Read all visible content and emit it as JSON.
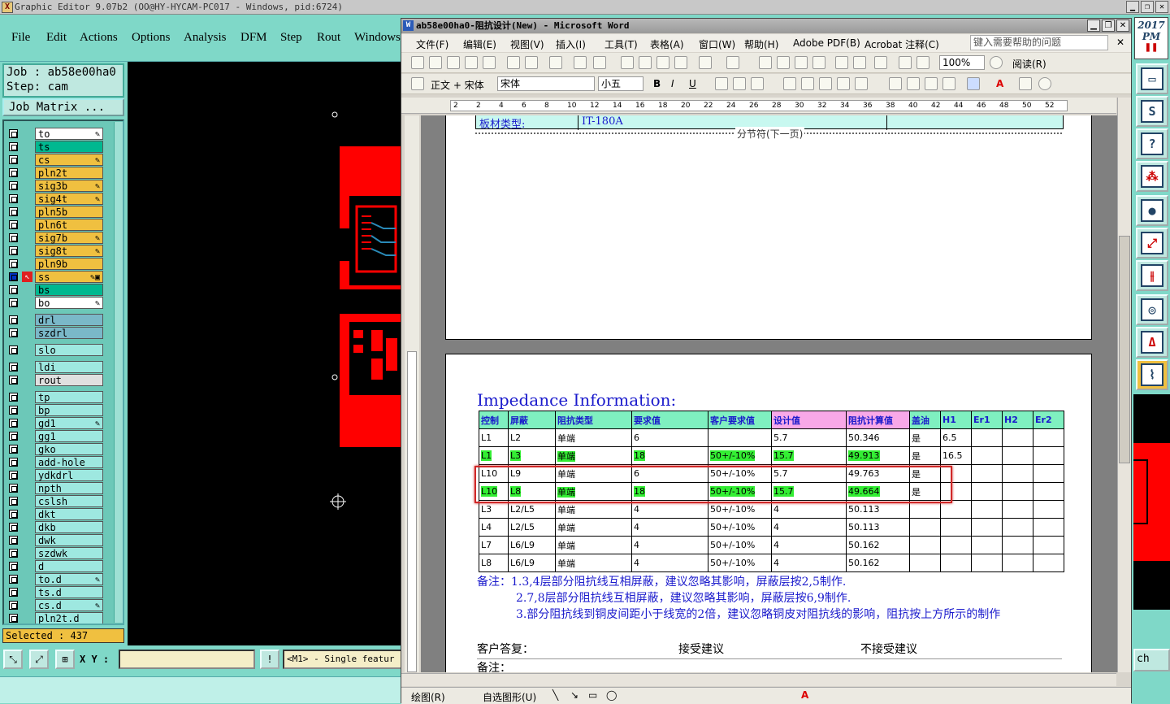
{
  "ge": {
    "title": "Graphic Editor 9.07b2 (OO@HY-HYCAM-PC017 - Windows, pid:6724)",
    "menu": [
      "File",
      "Edit",
      "Actions",
      "Options",
      "Analysis",
      "DFM",
      "Step",
      "Rout",
      "Windows"
    ],
    "job": "Job : ab58e00ha0",
    "step": "Step: cam",
    "job_matrix": "Job Matrix ...",
    "layers": [
      {
        "name": "to",
        "color": "#ffffff",
        "mark": "✎"
      },
      {
        "name": "ts",
        "color": "#00b890",
        "mark": ""
      },
      {
        "name": "cs",
        "color": "#f0c040",
        "mark": "✎"
      },
      {
        "name": "pln2t",
        "color": "#f0c040",
        "mark": ""
      },
      {
        "name": "sig3b",
        "color": "#f0c040",
        "mark": "✎"
      },
      {
        "name": "sig4t",
        "color": "#f0c040",
        "mark": "✎"
      },
      {
        "name": "pln5b",
        "color": "#f0c040",
        "mark": ""
      },
      {
        "name": "pln6t",
        "color": "#f0c040",
        "mark": ""
      },
      {
        "name": "sig7b",
        "color": "#f0c040",
        "mark": "✎"
      },
      {
        "name": "sig8t",
        "color": "#f0c040",
        "mark": "✎"
      },
      {
        "name": "pln9b",
        "color": "#f0c040",
        "mark": ""
      },
      {
        "name": "ss",
        "color": "#f0c040",
        "mark": "✎▣"
      },
      {
        "name": "bs",
        "color": "#00b890",
        "mark": ""
      },
      {
        "name": "bo",
        "color": "#ffffff",
        "mark": "✎"
      },
      {
        "name": "drl",
        "color": "#7ab8c8",
        "mark": ""
      },
      {
        "name": "szdrl",
        "color": "#7ab8c8",
        "mark": ""
      },
      {
        "name": "slo",
        "color": "#9ee8e0",
        "mark": ""
      },
      {
        "name": "ldi",
        "color": "#9ee8e0",
        "mark": ""
      },
      {
        "name": "rout",
        "color": "#e0e0e0",
        "mark": ""
      },
      {
        "name": "tp",
        "color": "#9ee8e0",
        "mark": ""
      },
      {
        "name": "bp",
        "color": "#9ee8e0",
        "mark": ""
      },
      {
        "name": "gd1",
        "color": "#9ee8e0",
        "mark": "✎"
      },
      {
        "name": "gg1",
        "color": "#9ee8e0",
        "mark": ""
      },
      {
        "name": "gko",
        "color": "#9ee8e0",
        "mark": ""
      },
      {
        "name": "add-hole",
        "color": "#9ee8e0",
        "mark": ""
      },
      {
        "name": "ydkdrl",
        "color": "#9ee8e0",
        "mark": ""
      },
      {
        "name": "npth",
        "color": "#9ee8e0",
        "mark": ""
      },
      {
        "name": "cslsh",
        "color": "#9ee8e0",
        "mark": ""
      },
      {
        "name": "dkt",
        "color": "#9ee8e0",
        "mark": ""
      },
      {
        "name": "dkb",
        "color": "#9ee8e0",
        "mark": ""
      },
      {
        "name": "dwk",
        "color": "#9ee8e0",
        "mark": ""
      },
      {
        "name": "szdwk",
        "color": "#9ee8e0",
        "mark": ""
      },
      {
        "name": "d",
        "color": "#9ee8e0",
        "mark": ""
      },
      {
        "name": "to.d",
        "color": "#9ee8e0",
        "mark": "✎"
      },
      {
        "name": "ts.d",
        "color": "#9ee8e0",
        "mark": ""
      },
      {
        "name": "cs.d",
        "color": "#9ee8e0",
        "mark": "✎"
      },
      {
        "name": "pln2t.d",
        "color": "#9ee8e0",
        "mark": ""
      }
    ],
    "selected": "Selected : 437",
    "xy_label": "X Y :",
    "message": "<M1> - Single featur",
    "clock_year": "2017",
    "clock_ampm": "PM",
    "right_edge_text": "ch"
  },
  "word": {
    "title": "ab58e00ha0-阻抗设计(New) - Microsoft Word",
    "menu": [
      "文件(F)",
      "编辑(E)",
      "视图(V)",
      "插入(I)",
      "工具(T)",
      "表格(A)",
      "窗口(W)",
      "帮助(H)",
      "Adobe PDF(B)",
      "Acrobat 注释(C)"
    ],
    "help_placeholder": "键入需要帮助的问题",
    "style": "正文 + 宋体",
    "font": "宋体",
    "size": "小五",
    "zoom": "100%",
    "read": "阅读(R)",
    "ruler_nums": [
      "2",
      "2",
      "4",
      "6",
      "8",
      "10",
      "12",
      "14",
      "16",
      "18",
      "20",
      "22",
      "24",
      "26",
      "28",
      "30",
      "32",
      "34",
      "36",
      "38",
      "40",
      "42",
      "44",
      "46",
      "48",
      "50",
      "52"
    ],
    "page1_row_label": "板材类型:",
    "page1_row_value": "IT-180A",
    "section_break": "分节符(下一页)",
    "imp_title": "Impedance Information:",
    "headers": [
      "控制",
      "屏蔽",
      "阻抗类型",
      "要求值",
      "客户要求值",
      "设计值",
      "阻抗计算值",
      "盖油",
      "H1",
      "Er1",
      "H2",
      "Er2"
    ],
    "rows": [
      {
        "hl": false,
        "cells": [
          "L1",
          "L2",
          "单端",
          "6",
          "",
          "5.7",
          "50.346",
          "是",
          "6.5",
          "",
          "",
          ""
        ]
      },
      {
        "hl": true,
        "cells": [
          "L1",
          "L3",
          "单端",
          "18",
          "50+/-10%",
          "15.7",
          "49.913",
          "是",
          "16.5",
          "",
          "",
          ""
        ]
      },
      {
        "hl": false,
        "cells": [
          "L10",
          "L9",
          "单端",
          "6",
          "50+/-10%",
          "5.7",
          "49.763",
          "是",
          "",
          "",
          "",
          ""
        ]
      },
      {
        "hl": true,
        "cells": [
          "L10",
          "L8",
          "单端",
          "18",
          "50+/-10%",
          "15.7",
          "49.664",
          "是",
          "",
          "",
          "",
          ""
        ]
      },
      {
        "hl": false,
        "cells": [
          "L3",
          "L2/L5",
          "单端",
          "4",
          "50+/-10%",
          "4",
          "50.113",
          "",
          "",
          "",
          "",
          ""
        ]
      },
      {
        "hl": false,
        "cells": [
          "L4",
          "L2/L5",
          "单端",
          "4",
          "50+/-10%",
          "4",
          "50.113",
          "",
          "",
          "",
          "",
          ""
        ]
      },
      {
        "hl": false,
        "cells": [
          "L7",
          "L6/L9",
          "单端",
          "4",
          "50+/-10%",
          "4",
          "50.162",
          "",
          "",
          "",
          "",
          ""
        ]
      },
      {
        "hl": false,
        "cells": [
          "L8",
          "L6/L9",
          "单端",
          "4",
          "50+/-10%",
          "4",
          "50.162",
          "",
          "",
          "",
          "",
          ""
        ]
      }
    ],
    "note1": "备注：1.3,4层部分阻抗线互相屏蔽，建议忽略其影响，屏蔽层按2,5制作.",
    "note2": "2.7,8层部分阻抗线互相屏蔽，建议忽略其影响，屏蔽层按6,9制作.",
    "note3": "3.部分阻抗线到铜皮间距小于线宽的2倍，建议忽略铜皮对阻抗线的影响，阻抗按上方所示的制作",
    "reply_label": "客户答复：",
    "accept": "接受建议",
    "reject": "不接受建议",
    "remark": "备注：",
    "draw_label": "绘图(R)",
    "autoshape": "自选图形(U)"
  }
}
